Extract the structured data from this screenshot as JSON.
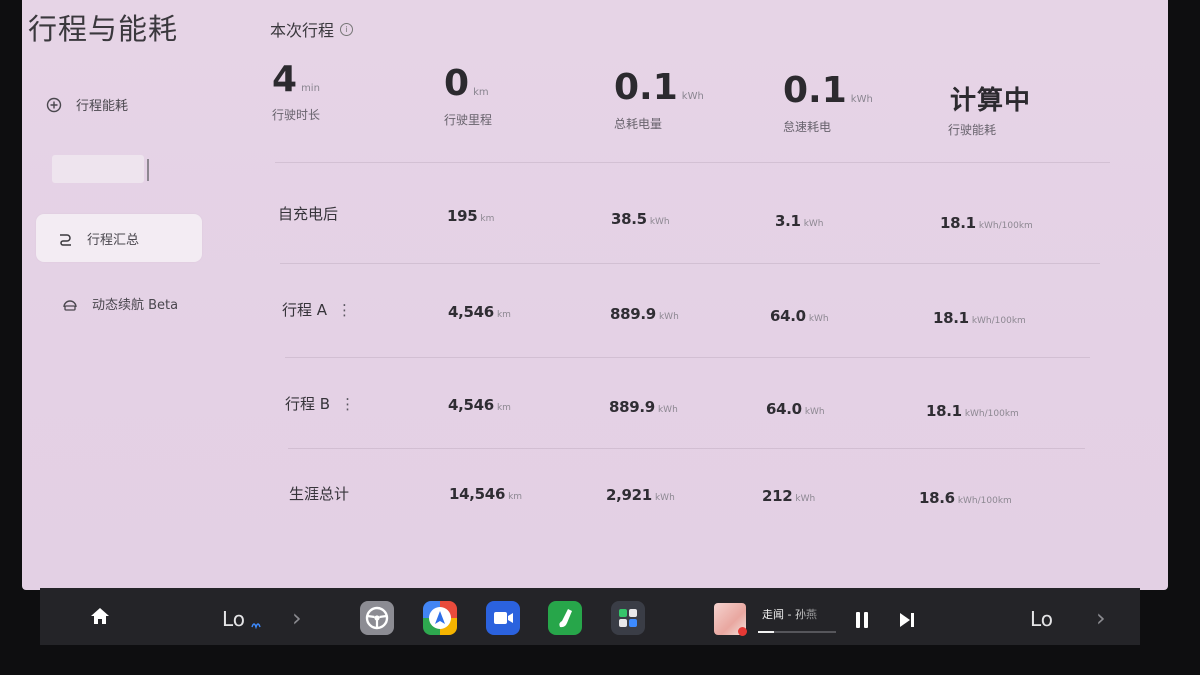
{
  "app": {
    "title": "行程与能耗"
  },
  "sidebar": {
    "items": [
      {
        "label": "行程能耗",
        "icon": "plus-circle-icon",
        "selected": false
      },
      {
        "label": "行程汇总",
        "icon": "trip-route-icon",
        "selected": true
      },
      {
        "label": "动态续航 Beta",
        "icon": "range-gauge-icon",
        "selected": false
      }
    ]
  },
  "current_trip": {
    "header": "本次行程",
    "info_icon": "info-icon",
    "stats": [
      {
        "value": "4",
        "unit": "min",
        "label": "行驶时长"
      },
      {
        "value": "0",
        "unit": "km",
        "label": "行驶里程"
      },
      {
        "value": "0.1",
        "unit": "kWh",
        "label": "总耗电量"
      },
      {
        "value": "0.1",
        "unit": "kWh",
        "label": "怠速耗电"
      },
      {
        "value": "计算中",
        "unit": "",
        "label": "行驶能耗"
      }
    ]
  },
  "summary": {
    "rows": [
      {
        "label": "自充电后",
        "menu": false,
        "distance": "195",
        "distance_unit": "km",
        "energy": "38.5",
        "energy_unit": "kWh",
        "idle": "3.1",
        "idle_unit": "kWh",
        "efficiency": "18.1",
        "efficiency_unit": "kWh/100km"
      },
      {
        "label": "行程 A",
        "menu": true,
        "menu_icon": "more-vertical-icon",
        "distance": "4,546",
        "distance_unit": "km",
        "energy": "889.9",
        "energy_unit": "kWh",
        "idle": "64.0",
        "idle_unit": "kWh",
        "efficiency": "18.1",
        "efficiency_unit": "kWh/100km"
      },
      {
        "label": "行程 B",
        "menu": true,
        "menu_icon": "more-vertical-icon",
        "distance": "4,546",
        "distance_unit": "km",
        "energy": "889.9",
        "energy_unit": "kWh",
        "idle": "64.0",
        "idle_unit": "kWh",
        "efficiency": "18.1",
        "efficiency_unit": "kWh/100km"
      },
      {
        "label": "生涯总计",
        "menu": false,
        "distance": "14,546",
        "distance_unit": "km",
        "energy": "2,921",
        "energy_unit": "kWh",
        "idle": "212",
        "idle_unit": "kWh",
        "efficiency": "18.6",
        "efficiency_unit": "kWh/100km"
      }
    ]
  },
  "taskbar": {
    "left_temp": "Lo",
    "right_temp": "Lo",
    "apps": [
      {
        "icon": "steering-wheel-icon"
      },
      {
        "icon": "navigation-icon"
      },
      {
        "icon": "video-camera-icon"
      },
      {
        "icon": "green-app-icon"
      },
      {
        "icon": "app-grid-icon"
      }
    ],
    "media": {
      "track": "走闻 - 孙燕",
      "progress": 0.2
    }
  },
  "colors": {
    "screen_bg": "#e6d4e6",
    "selected_bg": "#f3ecf3",
    "taskbar_bg": "#242428",
    "text": "#2b2a2f",
    "muted": "#67626c"
  }
}
